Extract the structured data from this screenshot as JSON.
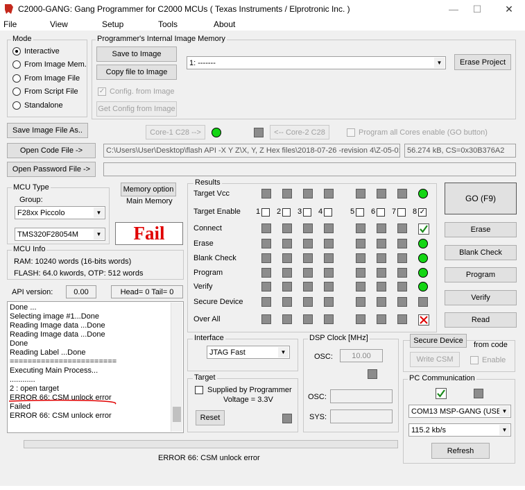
{
  "window": {
    "title": "C2000-GANG:  Gang Programmer for C2000  MCUs ( Texas Instruments / Elprotronic Inc. )",
    "minimize": "—",
    "maximize": "☐",
    "close": "✕"
  },
  "menu": [
    "File",
    "View",
    "Setup",
    "Tools",
    "About"
  ],
  "mode": {
    "title": "Mode",
    "options": [
      "Interactive",
      "From Image Mem.",
      "From Image File",
      "From Script File",
      "Standalone"
    ],
    "selected_index": 0
  },
  "image_memory": {
    "title": "Programmer's Internal Image Memory",
    "save_label": "Save to Image",
    "copy_label": "Copy file to Image",
    "config_from_image": "Config. from Image",
    "get_config": "Get Config from Image",
    "selected": "1: -------",
    "erase_project": "Erase Project"
  },
  "save_image_file": "Save Image File As..",
  "core1": "Core-1 C28 -->",
  "core2": "<-- Core-2 C28",
  "program_all_cores": "Program all Cores enable (GO button)",
  "open_code_file": "Open Code File ->",
  "code_file_path": "C:\\Users\\User\\Desktop\\flash API -X Y Z\\X, Y, Z Hex files\\2018-07-26 -revision 4\\Z-05-0:",
  "code_file_info": "56.274 kB, CS=0x30B376A2",
  "open_password_file": "Open Password File ->",
  "password_file_path": "",
  "mcu_type": {
    "title": "MCU Type",
    "group_label": "Group:",
    "group": "F28xx Piccolo",
    "device": "TMS320F28054M"
  },
  "memory_option": {
    "button": "Memory option",
    "value": "Main Memory"
  },
  "status_text": "Fail",
  "mcu_info": {
    "title": "MCU Info",
    "ram": "RAM: 10240 words (16-bits words)",
    "flash": "FLASH:  64.0 kwords,  OTP: 512 words"
  },
  "api": {
    "label": "API version:",
    "value": "0.00",
    "head_tail": "Head= 0  Tail= 0"
  },
  "log_lines": [
    "Done ...",
    "Selecting image #1...Done",
    "Reading Image data ...Done",
    "Reading Image data ...Done",
    " Done",
    "Reading Label ...Done",
    "========================",
    "Executing Main Process...",
    "............",
    "  2 : open target",
    "ERROR 66: CSM unlock error",
    "Failed",
    "ERROR 66: CSM unlock error"
  ],
  "results": {
    "title": "Results",
    "rows": [
      "Target Vcc",
      "Target Enable",
      "Connect",
      "Erase",
      "Blank Check",
      "Program",
      "Verify",
      "Secure Device",
      "Over All"
    ],
    "target_numbers": [
      "1",
      "2",
      "3",
      "4",
      "5",
      "6",
      "7",
      "8"
    ],
    "check_mark": "✓",
    "cross_mark": "✕"
  },
  "buttons": {
    "go": "GO    (F9)",
    "erase": "Erase",
    "blank_check": "Blank Check",
    "program": "Program",
    "verify": "Verify",
    "read": "Read"
  },
  "interface": {
    "title": "Interface",
    "value": "JTAG Fast"
  },
  "dsp_clock": {
    "title": "DSP Clock [MHz]",
    "osc_label": "OSC:",
    "osc_value": "10.00",
    "osc2_label": "OSC:",
    "sys_label": "SYS:"
  },
  "target": {
    "title": "Target",
    "supplied": "Supplied by Programmer",
    "voltage": "Voltage = 3.3V",
    "reset": "Reset"
  },
  "secure": {
    "button": "Secure Device",
    "from_code": "from code",
    "write_csm": "Write CSM",
    "enable": "Enable"
  },
  "pc_comm": {
    "title": "PC Communication",
    "port": "COM13  MSP-GANG (USE",
    "baud": "115.2 kb/s",
    "refresh": "Refresh"
  },
  "status_bar": "ERROR 66: CSM unlock error",
  "colors": {
    "green": "#14d614",
    "fail_red": "#e00000",
    "error_underline": "#e00000"
  }
}
